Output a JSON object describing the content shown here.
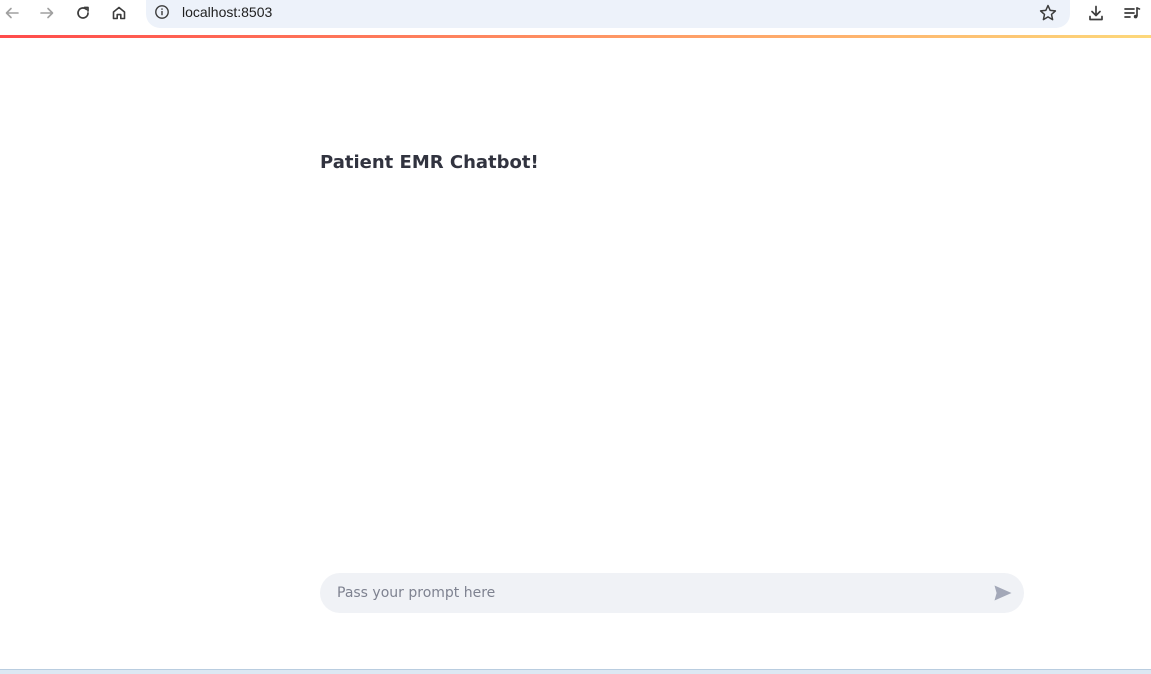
{
  "browser": {
    "url": "localhost:8503",
    "icons": [
      "back-arrow-icon",
      "forward-arrow-icon",
      "reload-icon",
      "home-icon",
      "site-info-icon",
      "bookmark-star-icon",
      "download-icon",
      "reading-list-icon"
    ]
  },
  "colors": {
    "accent_start": "#ff4b4b",
    "accent_end": "#fdd87a",
    "title": "#31333f",
    "input_bg": "#f0f2f6",
    "placeholder": "#7e8290",
    "send_icon": "#a3a8b8"
  },
  "main": {
    "title": "Patient EMR Chatbot!"
  },
  "chat": {
    "placeholder": "Pass your prompt here",
    "value": ""
  }
}
